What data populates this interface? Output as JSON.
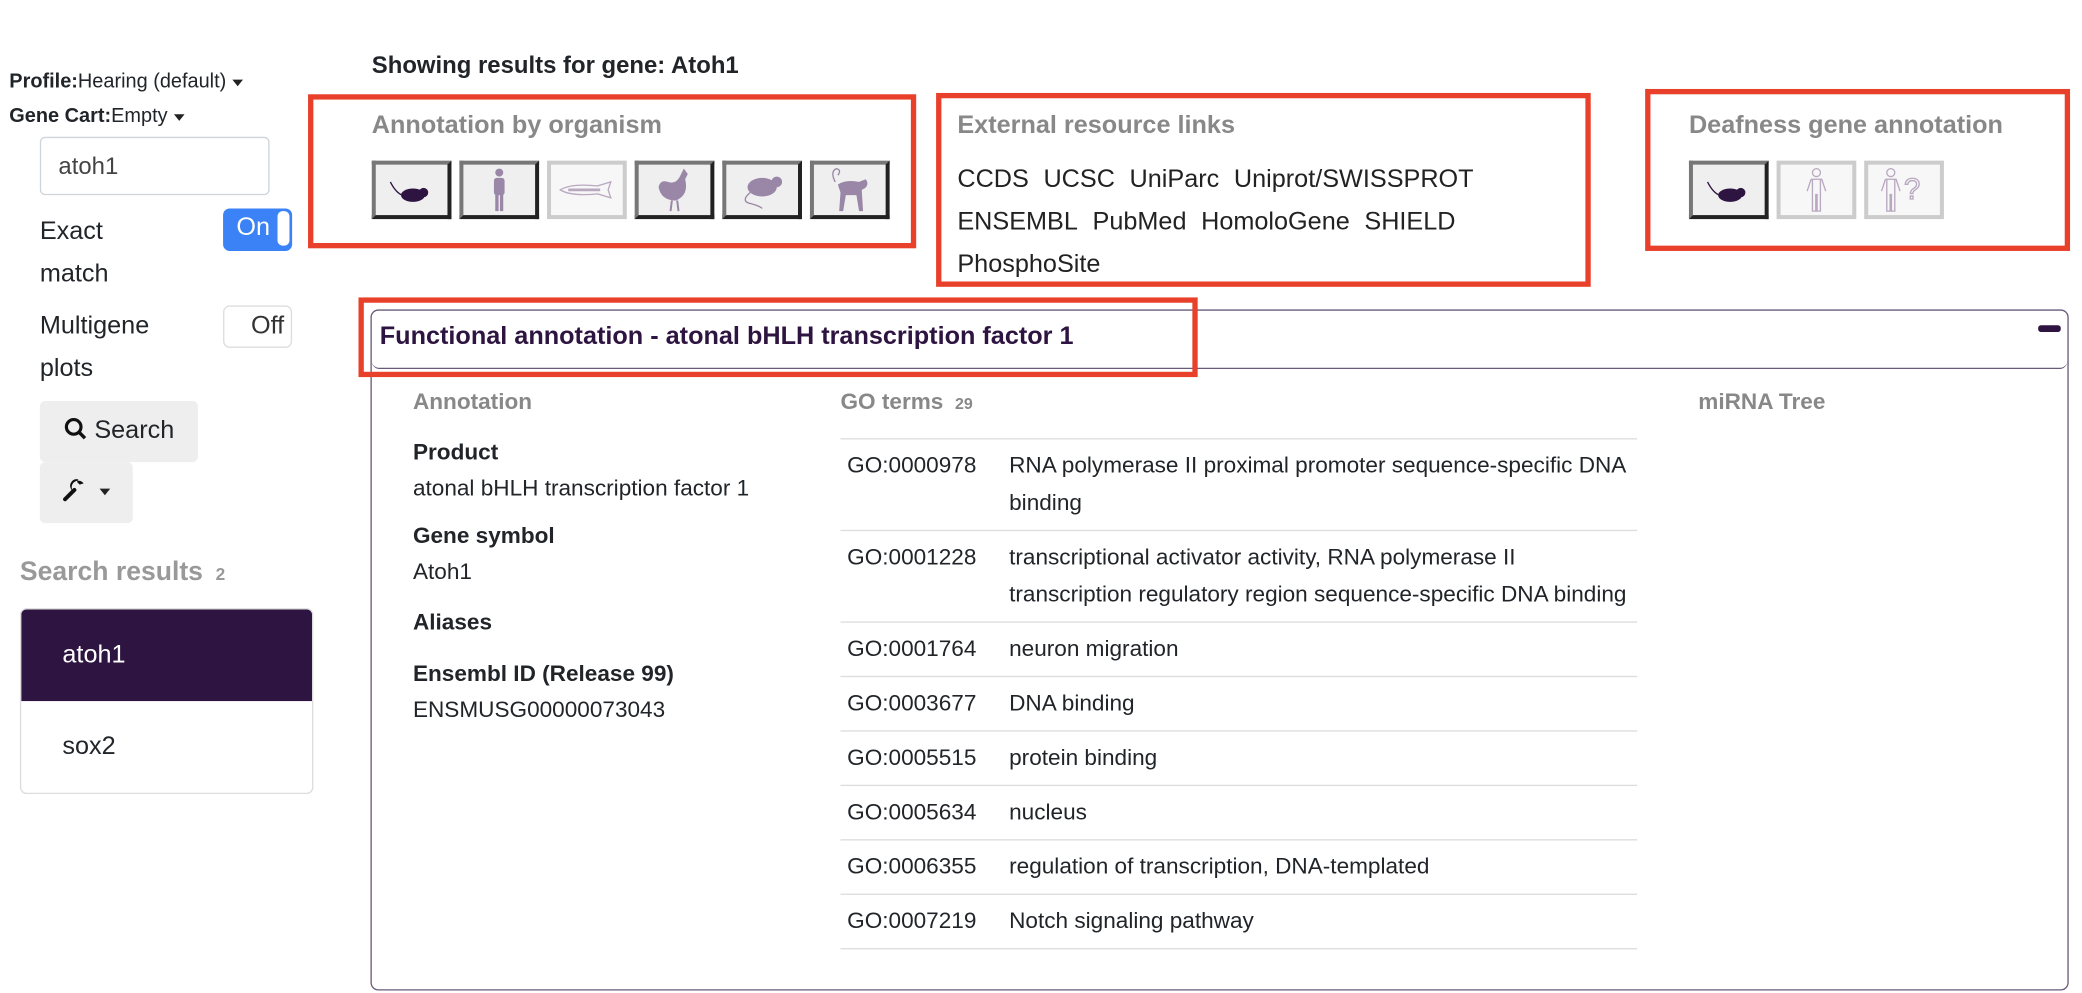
{
  "sidebar": {
    "profile_label": "Profile:",
    "profile_value": "Hearing (default)",
    "cart_label": "Gene Cart:",
    "cart_value": "Empty",
    "search_value": "atoh1",
    "exact_match_label_1": "Exact",
    "exact_match_label_2": "match",
    "exact_match_state": "On",
    "multigene_label_1": "Multigene",
    "multigene_label_2": "plots",
    "multigene_state": "Off",
    "search_button": "Search",
    "results_title": "Search results",
    "results_count": "2",
    "results": [
      "atoh1",
      "sox2"
    ]
  },
  "main": {
    "title": "Showing results for gene: Atoh1",
    "organism": {
      "heading": "Annotation by organism",
      "icons": [
        "mouse-icon",
        "human-icon",
        "zebrafish-icon",
        "chicken-icon",
        "rat-icon",
        "monkey-icon"
      ]
    },
    "external": {
      "heading": "External resource links",
      "links": [
        "CCDS",
        "UCSC",
        "UniParc",
        "Uniprot/SWISSPROT",
        "ENSEMBL",
        "PubMed",
        "HomoloGene",
        "SHIELD",
        "PhosphoSite"
      ]
    },
    "deafness": {
      "heading": "Deafness gene annotation",
      "icons": [
        "mouse-icon",
        "human-icon",
        "human-unknown-icon"
      ]
    },
    "functional": {
      "title": "Functional annotation - atonal bHLH transcription factor 1",
      "annotation_heading": "Annotation",
      "product_label": "Product",
      "product_value": "atonal bHLH transcription factor 1",
      "symbol_label": "Gene symbol",
      "symbol_value": "Atoh1",
      "aliases_label": "Aliases",
      "ensembl_label": "Ensembl ID (Release 99)",
      "ensembl_value": "ENSMUSG00000073043",
      "go_heading": "GO terms",
      "go_count": "29",
      "go_terms": [
        {
          "id": "GO:0000978",
          "desc": "RNA polymerase II proximal promoter sequence-specific DNA binding"
        },
        {
          "id": "GO:0001228",
          "desc": "transcriptional activator activity, RNA polymerase II transcription regulatory region sequence-specific DNA binding"
        },
        {
          "id": "GO:0001764",
          "desc": "neuron migration"
        },
        {
          "id": "GO:0003677",
          "desc": "DNA binding"
        },
        {
          "id": "GO:0005515",
          "desc": "protein binding"
        },
        {
          "id": "GO:0005634",
          "desc": "nucleus"
        },
        {
          "id": "GO:0006355",
          "desc": "regulation of transcription, DNA-templated"
        },
        {
          "id": "GO:0007219",
          "desc": "Notch signaling pathway"
        }
      ],
      "mirna_heading": "miRNA Tree"
    }
  },
  "colors": {
    "highlight": "#e8402a",
    "brand": "#2e1440",
    "toggle_on": "#3b82f6"
  }
}
